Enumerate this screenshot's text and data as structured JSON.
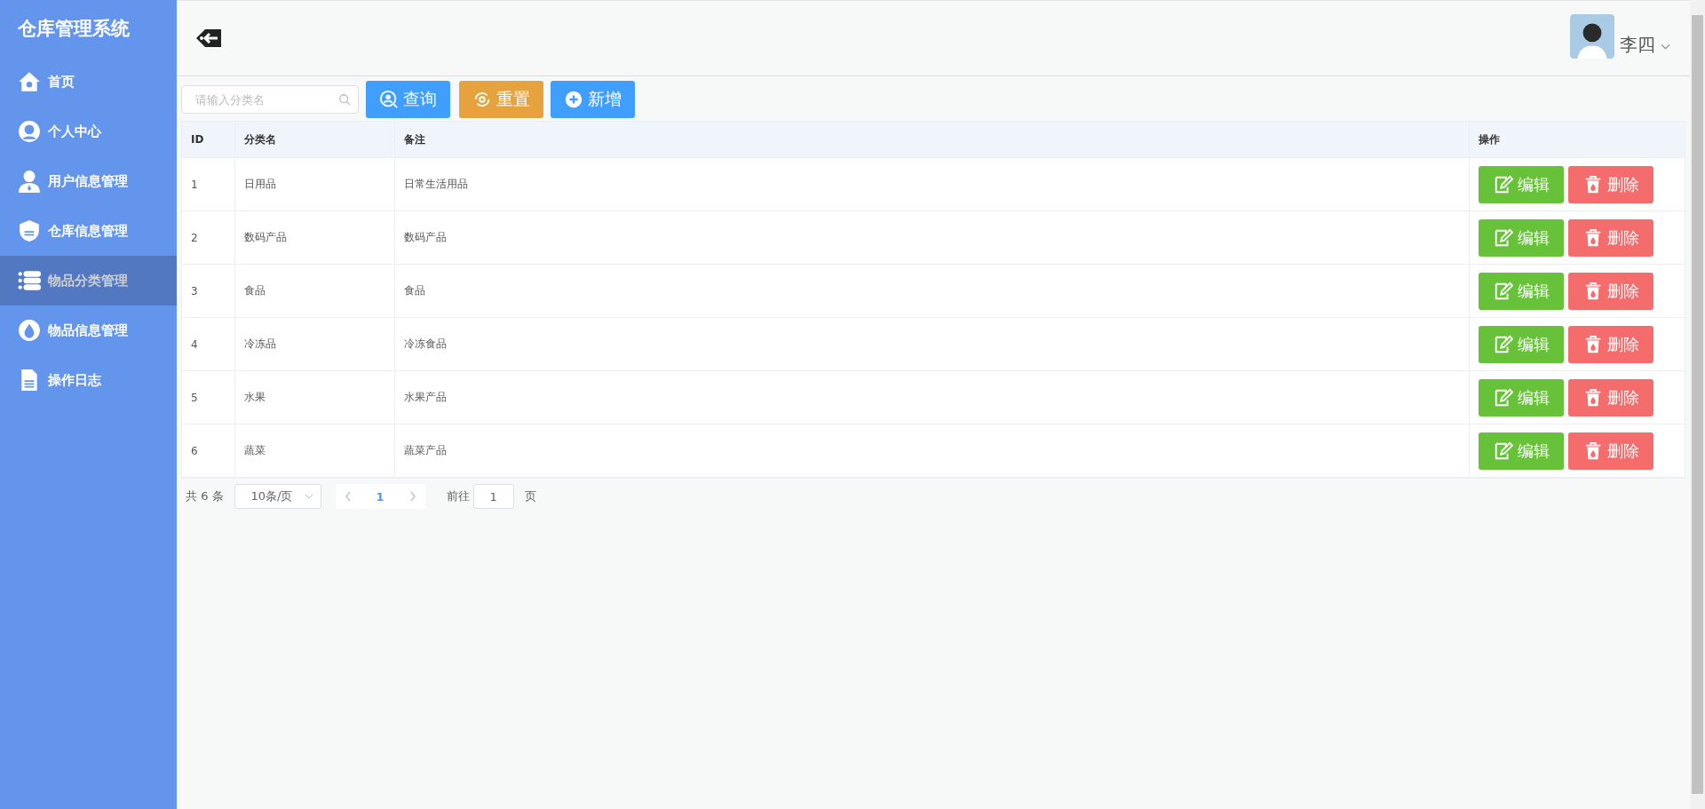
{
  "sidebar": {
    "title": "仓库管理系统",
    "items": [
      {
        "label": "首页",
        "selected": false
      },
      {
        "label": "个人中心",
        "selected": false
      },
      {
        "label": "用户信息管理",
        "selected": false
      },
      {
        "label": "仓库信息管理",
        "selected": false
      },
      {
        "label": "物品分类管理",
        "selected": true
      },
      {
        "label": "物品信息管理",
        "selected": false
      },
      {
        "label": "操作日志",
        "selected": false
      }
    ]
  },
  "header": {
    "user_name": "李四"
  },
  "toolbar": {
    "search": {
      "placeholder": "请输入分类名"
    },
    "buttons": [
      {
        "label": "查询",
        "kind": "search"
      },
      {
        "label": "重置",
        "kind": "reset"
      },
      {
        "label": "新增",
        "kind": "add"
      }
    ]
  },
  "table": {
    "columns": [
      "ID",
      "分类名",
      "备注",
      "操作"
    ],
    "rows": [
      {
        "id": "1",
        "name": "日用品",
        "note": "日常生活用品",
        "actions": [
          "编辑",
          "删除"
        ]
      },
      {
        "id": "2",
        "name": "数码产品",
        "note": "数码产品",
        "actions": [
          "编辑",
          "删除"
        ]
      },
      {
        "id": "3",
        "name": "食品",
        "note": "食品",
        "actions": [
          "编辑",
          "删除"
        ]
      },
      {
        "id": "4",
        "name": "冷冻品",
        "note": "冷冻食品",
        "actions": [
          "编辑",
          "删除"
        ]
      },
      {
        "id": "5",
        "name": "水果",
        "note": "水果产品",
        "actions": [
          "编辑",
          "删除"
        ]
      },
      {
        "id": "6",
        "name": "蔬菜",
        "note": "蔬菜产品",
        "actions": [
          "编辑",
          "删除"
        ]
      }
    ]
  },
  "pagination": {
    "total": "共 6 条",
    "page_size": "10条/页",
    "pages": [
      {
        "label": "1",
        "selected": true
      }
    ],
    "goto_label": "前往",
    "goto_value": "1",
    "page_suffix": "页"
  }
}
